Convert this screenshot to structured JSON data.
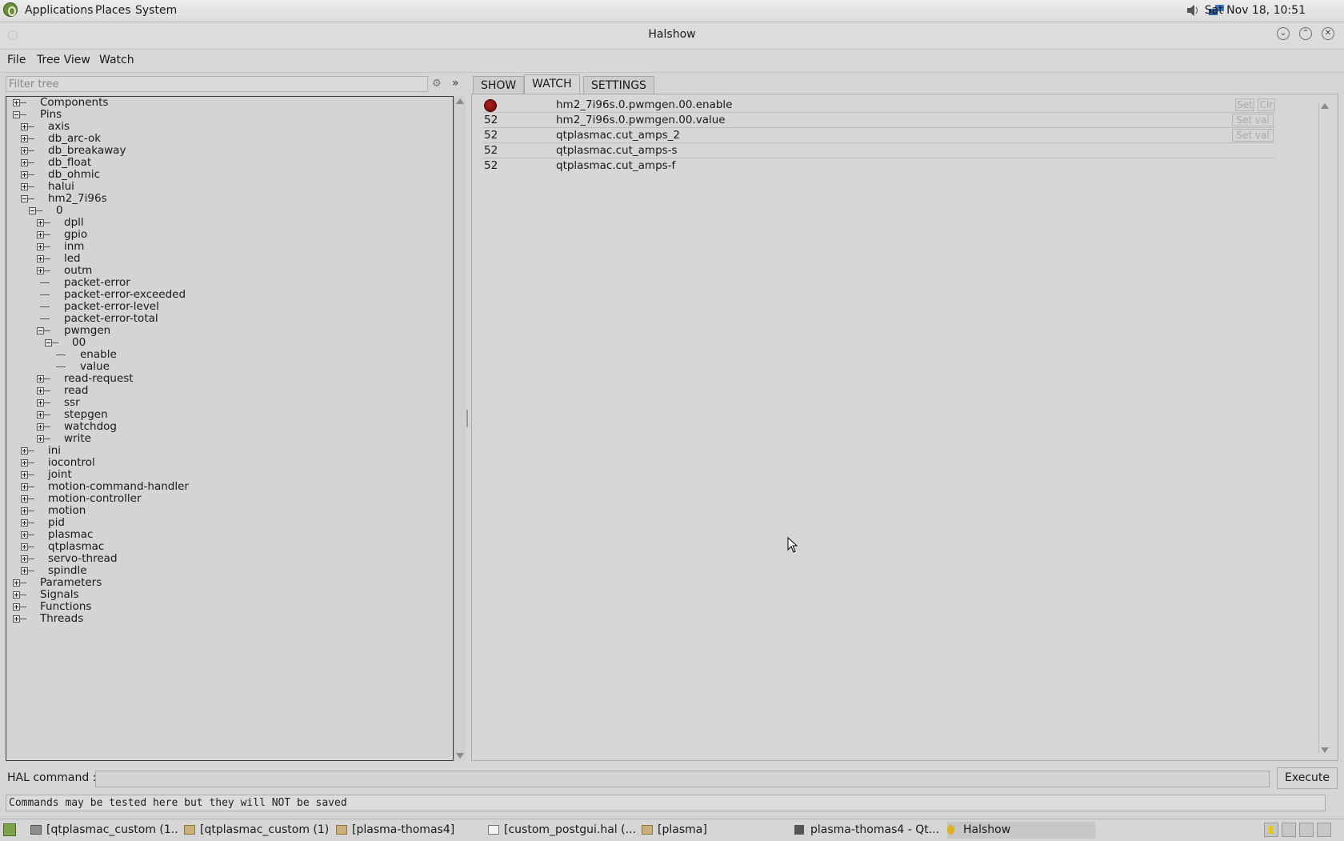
{
  "top_panel": {
    "menus": [
      "Applications",
      "Places",
      "System"
    ],
    "clock": "Sat Nov 18, 10:51"
  },
  "window": {
    "title": "Halshow",
    "menubar": [
      "File",
      "Tree View",
      "Watch"
    ]
  },
  "tree": {
    "filter_placeholder": "Filter tree",
    "collapse_glyph": "»",
    "nodes": [
      {
        "label": "Components",
        "depth": 0,
        "state": "collapsed"
      },
      {
        "label": "Pins",
        "depth": 0,
        "state": "expanded"
      },
      {
        "label": "axis",
        "depth": 1,
        "state": "collapsed"
      },
      {
        "label": "db_arc-ok",
        "depth": 1,
        "state": "collapsed"
      },
      {
        "label": "db_breakaway",
        "depth": 1,
        "state": "collapsed"
      },
      {
        "label": "db_float",
        "depth": 1,
        "state": "collapsed"
      },
      {
        "label": "db_ohmic",
        "depth": 1,
        "state": "collapsed"
      },
      {
        "label": "halui",
        "depth": 1,
        "state": "collapsed"
      },
      {
        "label": "hm2_7i96s",
        "depth": 1,
        "state": "expanded"
      },
      {
        "label": "0",
        "depth": 2,
        "state": "expanded"
      },
      {
        "label": "dpll",
        "depth": 3,
        "state": "collapsed"
      },
      {
        "label": "gpio",
        "depth": 3,
        "state": "collapsed"
      },
      {
        "label": "inm",
        "depth": 3,
        "state": "collapsed"
      },
      {
        "label": "led",
        "depth": 3,
        "state": "collapsed"
      },
      {
        "label": "outm",
        "depth": 3,
        "state": "collapsed"
      },
      {
        "label": "packet-error",
        "depth": 3,
        "state": "leaf"
      },
      {
        "label": "packet-error-exceeded",
        "depth": 3,
        "state": "leaf"
      },
      {
        "label": "packet-error-level",
        "depth": 3,
        "state": "leaf"
      },
      {
        "label": "packet-error-total",
        "depth": 3,
        "state": "leaf"
      },
      {
        "label": "pwmgen",
        "depth": 3,
        "state": "expanded"
      },
      {
        "label": "00",
        "depth": 4,
        "state": "expanded"
      },
      {
        "label": "enable",
        "depth": 5,
        "state": "leaf"
      },
      {
        "label": "value",
        "depth": 5,
        "state": "leaf"
      },
      {
        "label": "read-request",
        "depth": 3,
        "state": "collapsed"
      },
      {
        "label": "read",
        "depth": 3,
        "state": "collapsed"
      },
      {
        "label": "ssr",
        "depth": 3,
        "state": "collapsed"
      },
      {
        "label": "stepgen",
        "depth": 3,
        "state": "collapsed"
      },
      {
        "label": "watchdog",
        "depth": 3,
        "state": "collapsed"
      },
      {
        "label": "write",
        "depth": 3,
        "state": "collapsed"
      },
      {
        "label": "ini",
        "depth": 1,
        "state": "collapsed"
      },
      {
        "label": "iocontrol",
        "depth": 1,
        "state": "collapsed"
      },
      {
        "label": "joint",
        "depth": 1,
        "state": "collapsed"
      },
      {
        "label": "motion-command-handler",
        "depth": 1,
        "state": "collapsed"
      },
      {
        "label": "motion-controller",
        "depth": 1,
        "state": "collapsed"
      },
      {
        "label": "motion",
        "depth": 1,
        "state": "collapsed"
      },
      {
        "label": "pid",
        "depth": 1,
        "state": "collapsed"
      },
      {
        "label": "plasmac",
        "depth": 1,
        "state": "collapsed"
      },
      {
        "label": "qtplasmac",
        "depth": 1,
        "state": "collapsed"
      },
      {
        "label": "servo-thread",
        "depth": 1,
        "state": "collapsed"
      },
      {
        "label": "spindle",
        "depth": 1,
        "state": "collapsed"
      },
      {
        "label": "Parameters",
        "depth": 0,
        "state": "collapsed"
      },
      {
        "label": "Signals",
        "depth": 0,
        "state": "collapsed"
      },
      {
        "label": "Functions",
        "depth": 0,
        "state": "collapsed"
      },
      {
        "label": "Threads",
        "depth": 0,
        "state": "collapsed"
      }
    ]
  },
  "tabs": [
    "SHOW",
    "WATCH",
    "SETTINGS"
  ],
  "active_tab": "WATCH",
  "watch": {
    "rows": [
      {
        "value": "",
        "indicator": "led-red",
        "name": "hm2_7i96s.0.pwmgen.00.enable",
        "buttons": [
          "Set",
          "Clr"
        ]
      },
      {
        "value": "52",
        "name": "hm2_7i96s.0.pwmgen.00.value",
        "buttons": [
          "Set val"
        ]
      },
      {
        "value": "52",
        "name": "qtplasmac.cut_amps_2",
        "buttons": [
          "Set val"
        ]
      },
      {
        "value": "52",
        "name": "qtplasmac.cut_amps-s",
        "buttons": []
      },
      {
        "value": "52",
        "name": "qtplasmac.cut_amps-f",
        "buttons": []
      }
    ],
    "led_color": "#8b1010"
  },
  "hal": {
    "label": "HAL command :",
    "input_value": "",
    "execute_label": "Execute",
    "status": "Commands may be tested here but they will NOT be saved"
  },
  "taskbar": {
    "items": [
      {
        "label": "[qtplasmac_custom (1...",
        "icon": "terminal-icon"
      },
      {
        "label": "[qtplasmac_custom (1)]",
        "icon": "folder-icon"
      },
      {
        "label": "[plasma-thomas4]",
        "icon": "folder-icon"
      },
      {
        "label": "[custom_postgui.hal (...",
        "icon": "text-editor-icon"
      },
      {
        "label": "[plasma]",
        "icon": "folder-icon"
      },
      {
        "label": "plasma-thomas4 - Qt...",
        "icon": "qtplasmac-icon"
      },
      {
        "label": "Halshow",
        "icon": "halshow-icon"
      }
    ]
  }
}
